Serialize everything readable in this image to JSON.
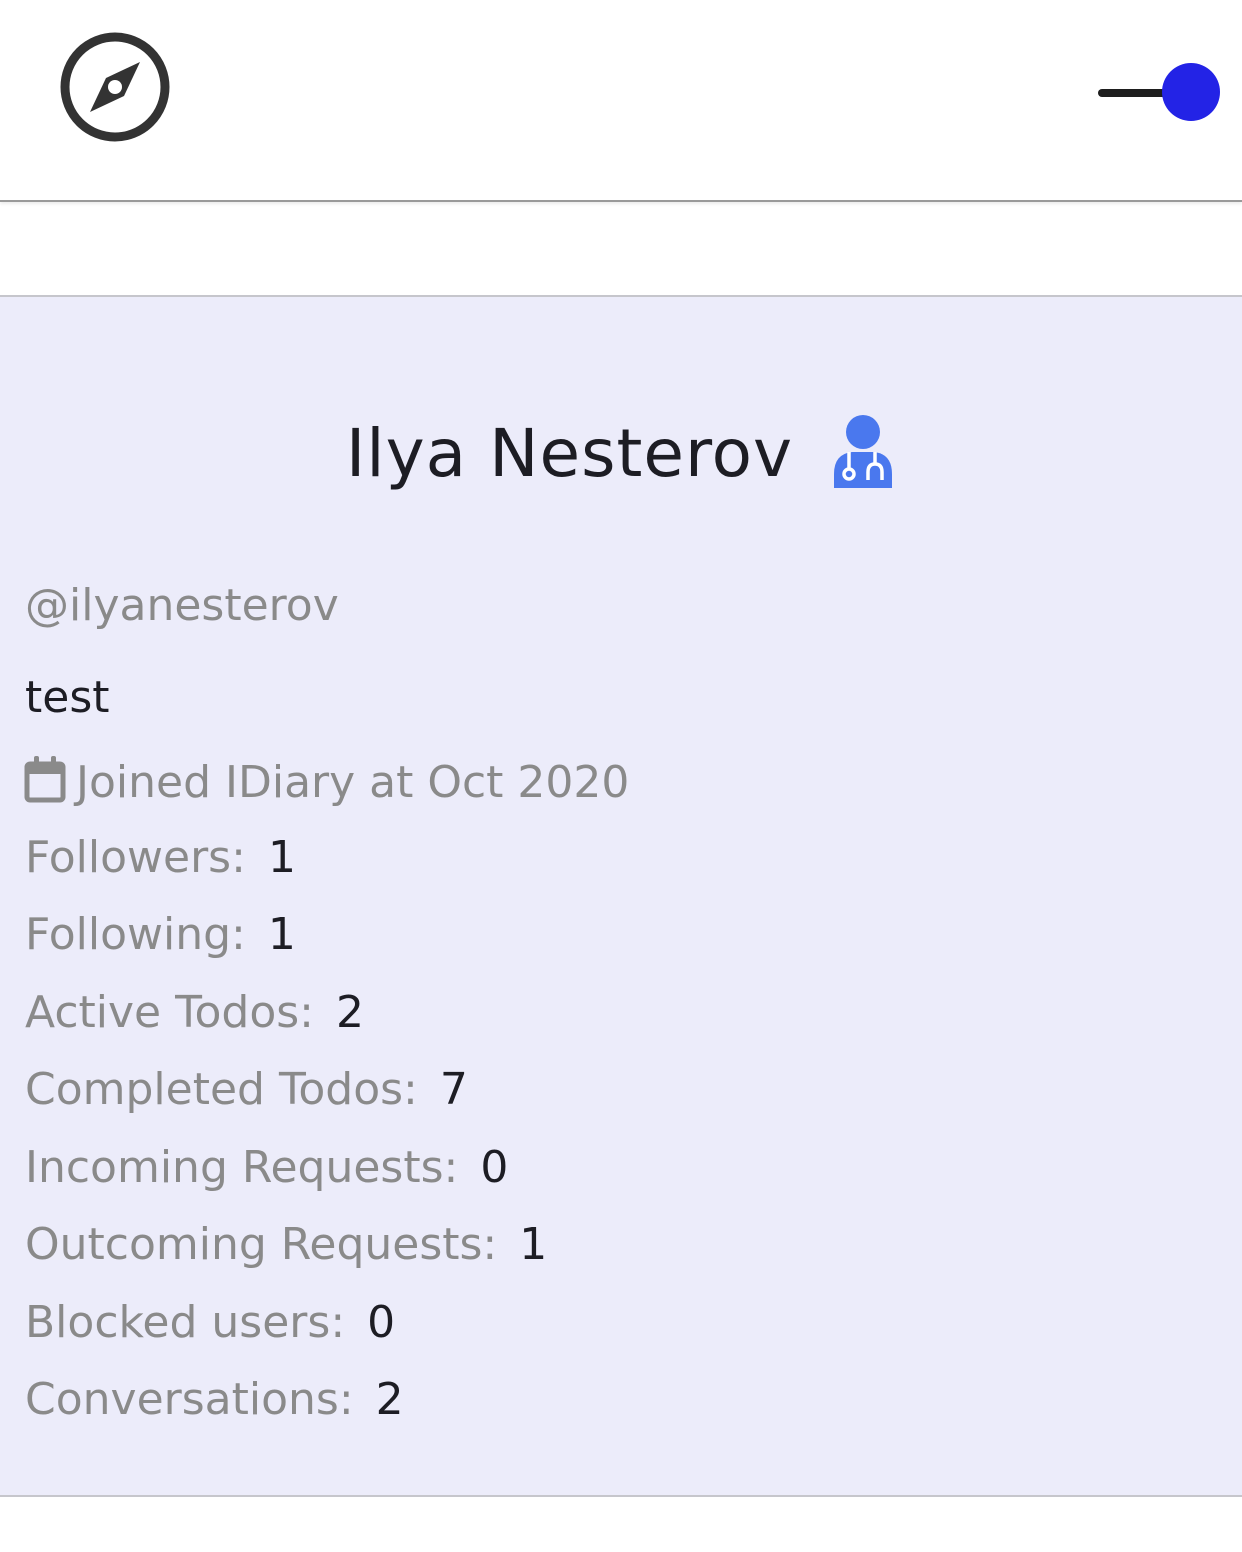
{
  "colors": {
    "toggle_knob": "#2323e6",
    "card_background": "#ececfa",
    "icon_dark": "#333333",
    "doctor_icon": "#4a78ee"
  },
  "header": {
    "nav_icon": "compass-icon",
    "theme_toggle": {
      "state": "on",
      "icon": "toggle-switch"
    }
  },
  "profile": {
    "name": "Ilya Nesterov",
    "role_icon": "user-doctor-icon",
    "username": "@ilyanesterov",
    "bio": "test",
    "joined_icon": "calendar-icon",
    "joined": "Joined IDiary at Oct 2020",
    "stats": [
      {
        "label": "Followers:",
        "value": "1"
      },
      {
        "label": "Following:",
        "value": "1"
      },
      {
        "label": "Active Todos:",
        "value": "2"
      },
      {
        "label": "Completed Todos:",
        "value": "7"
      },
      {
        "label": "Incoming Requests:",
        "value": "0"
      },
      {
        "label": "Outcoming Requests:",
        "value": "1"
      },
      {
        "label": "Blocked users:",
        "value": "0"
      },
      {
        "label": "Conversations:",
        "value": "2"
      }
    ]
  }
}
